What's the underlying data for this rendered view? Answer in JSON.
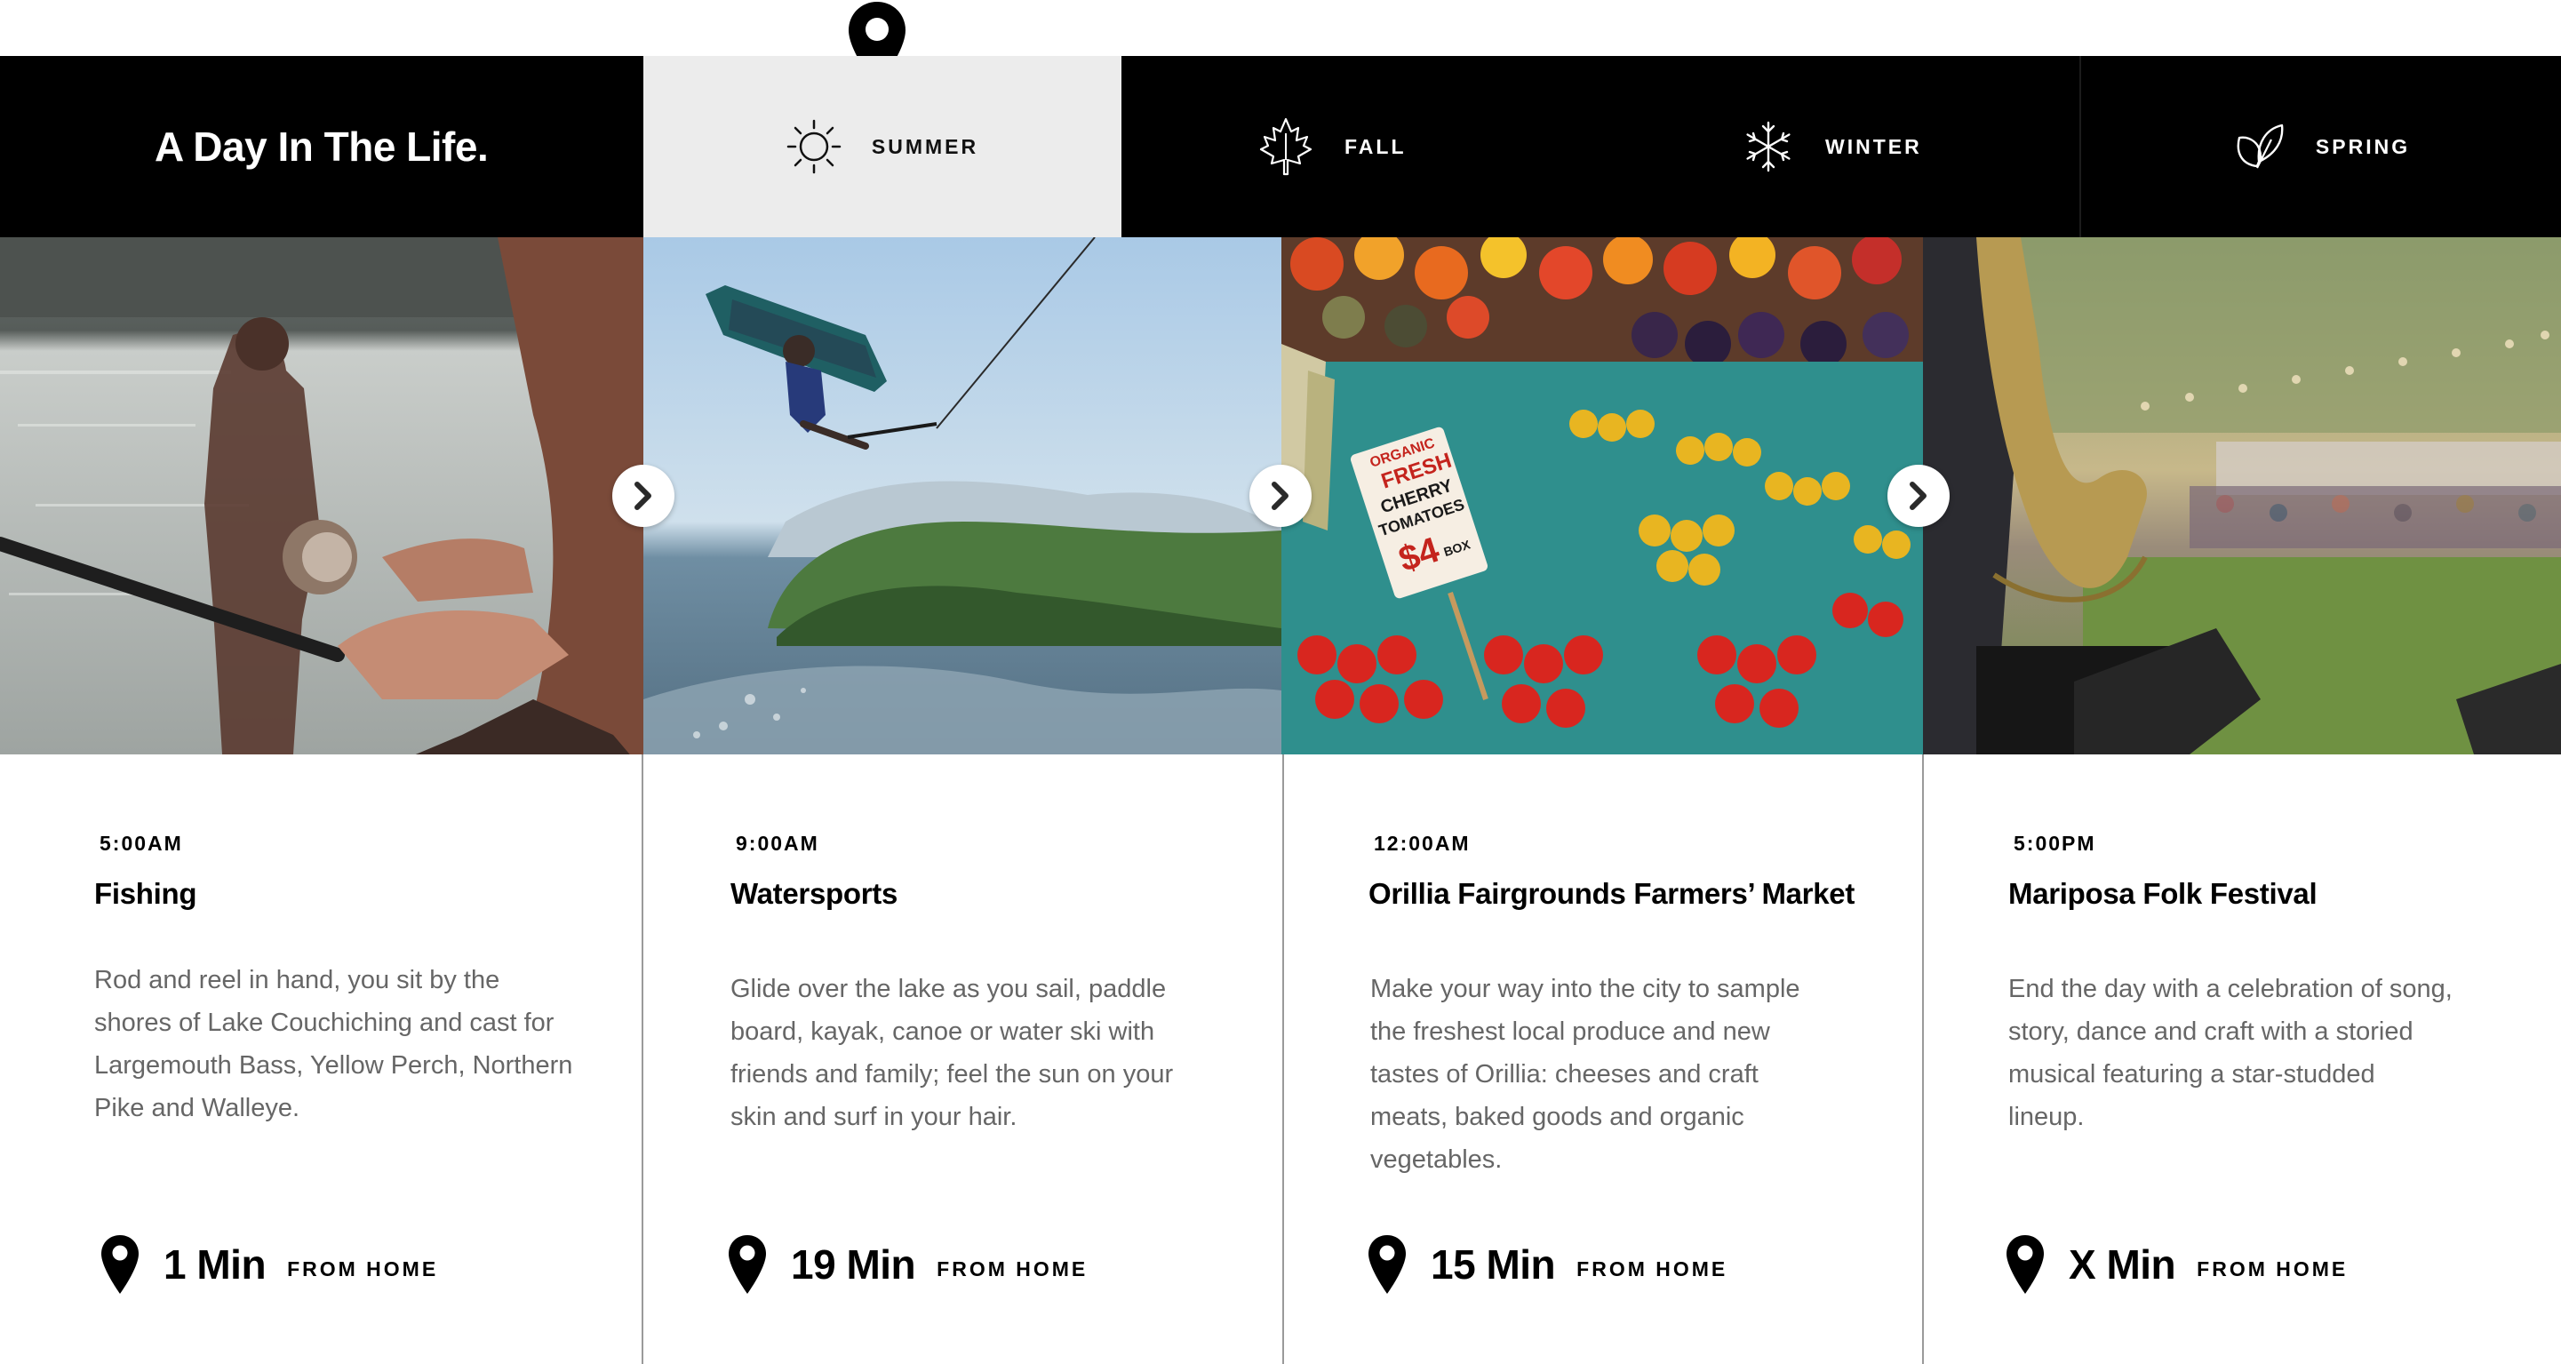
{
  "header": {
    "brand_title": "A Day In The Life.",
    "active_tab": "summer",
    "tabs": [
      {
        "id": "summer",
        "label": "SUMMER",
        "icon": "sun-icon"
      },
      {
        "id": "fall",
        "label": "FALL",
        "icon": "maple-leaf-icon"
      },
      {
        "id": "winter",
        "label": "WINTER",
        "icon": "snowflake-icon"
      },
      {
        "id": "spring",
        "label": "SPRING",
        "icon": "sprout-leaf-icon"
      }
    ]
  },
  "cards": [
    {
      "time": "5:00AM",
      "title": "Fishing",
      "description": "Rod and reel in hand, you sit by the shores of Lake Couchiching and cast for Largemouth Bass, Yellow Perch, Northern Pike and Walleye.",
      "minutes": "1 Min",
      "from_home": "FROM HOME",
      "image": "fishing-photo"
    },
    {
      "time": "9:00AM",
      "title": "Watersports",
      "description": "Glide over the lake as you sail, paddle board, kayak, canoe or water ski with friends and family; feel the sun on your skin and surf in your hair.",
      "minutes": "19 Min",
      "from_home": "FROM HOME",
      "image": "wakeboarding-photo"
    },
    {
      "time": "12:00AM",
      "title": "Orillia Fairgrounds Farmers’ Market",
      "description": "Make your way into the city to sample the freshest local produce and new tastes of Orillia: cheeses and craft meats, baked goods and organic vegetables.",
      "minutes": "15 Min",
      "from_home": "FROM HOME",
      "image": "farmers-market-photo"
    },
    {
      "time": "5:00PM",
      "title": "Mariposa Folk Festival",
      "description": "End the day with a celebration of song, story, dance and craft with a storied musical featuring a star-studded lineup.",
      "minutes": "X Min",
      "from_home": "FROM HOME",
      "image": "folk-festival-photo"
    }
  ],
  "photo_text": {
    "market_sign_line1": "ORGANIC",
    "market_sign_line2": "FRESH",
    "market_sign_line3": "CHERRY",
    "market_sign_line4": "TOMATOES",
    "market_sign_price": "$4",
    "market_sign_unit": "BOX"
  },
  "colors": {
    "bar": "#000000",
    "active_tab": "#ececec",
    "text": "#000000",
    "description": "#666666",
    "divider": "#9a9a9a"
  }
}
